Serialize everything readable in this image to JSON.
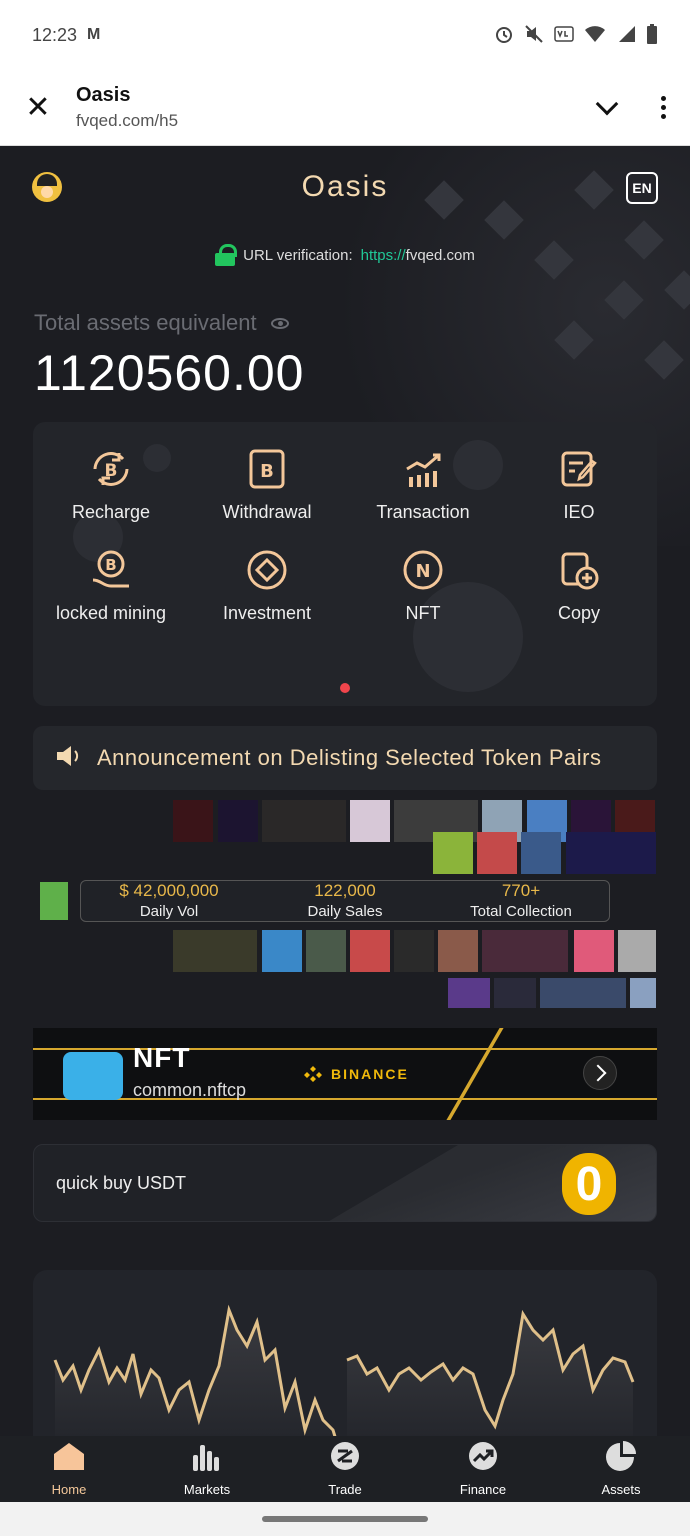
{
  "status_bar": {
    "time": "12:23",
    "carrier_icon": "M",
    "icons": [
      "alarm-icon",
      "mute-icon",
      "volte-icon",
      "wifi-icon",
      "signal-icon",
      "battery-icon"
    ]
  },
  "browser": {
    "title": "Oasis",
    "url": "fvqed.com/h5"
  },
  "header": {
    "brand": "Oasis",
    "lang": "EN"
  },
  "url_verification": {
    "label": "URL verification:",
    "scheme": "https://",
    "domain": "fvqed.com"
  },
  "assets": {
    "label": "Total assets equivalent",
    "value": "1120560.00"
  },
  "menu": [
    {
      "label": "Recharge",
      "icon": "recharge-bitcoin-icon"
    },
    {
      "label": "Withdrawal",
      "icon": "withdrawal-bitcoin-icon"
    },
    {
      "label": "Transaction",
      "icon": "transaction-chart-icon"
    },
    {
      "label": "IEO",
      "icon": "ieo-document-icon"
    },
    {
      "label": "locked mining",
      "icon": "locked-mining-icon"
    },
    {
      "label": "Investment",
      "icon": "investment-icon"
    },
    {
      "label": "NFT",
      "icon": "nft-icon"
    },
    {
      "label": "Copy",
      "icon": "copy-add-icon"
    }
  ],
  "announcement": {
    "text": "Announcement on Delisting Selected Token Pairs"
  },
  "nft_stats": [
    {
      "value": "$ 42,000,000",
      "label": "Daily Vol"
    },
    {
      "value": "122,000",
      "label": "Daily Sales"
    },
    {
      "value": "770+",
      "label": "Total Collection"
    }
  ],
  "banner": {
    "logo": "NFT",
    "sub": "common.nftcp",
    "partner": "BINANCE"
  },
  "quick_buy": {
    "label": "quick buy USDT"
  },
  "tabbar": [
    {
      "label": "Home",
      "icon": "home-icon",
      "active": true
    },
    {
      "label": "Markets",
      "icon": "markets-icon"
    },
    {
      "label": "Trade",
      "icon": "trade-icon"
    },
    {
      "label": "Finance",
      "icon": "finance-icon"
    },
    {
      "label": "Assets",
      "icon": "assets-pie-icon"
    }
  ],
  "colors": {
    "accent": "#f3d9b1",
    "gold": "#e8b84a",
    "verify_green": "#22c55e",
    "background": "#1c1d22"
  }
}
